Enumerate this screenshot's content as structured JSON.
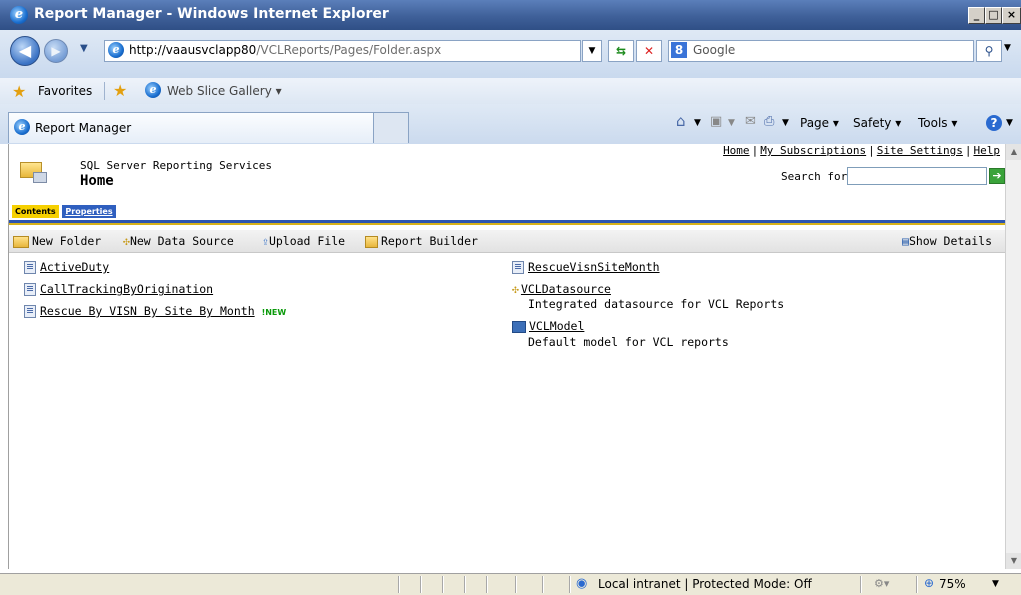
{
  "window": {
    "title": "Report Manager - Windows Internet Explorer",
    "controls": {
      "minimize": "_",
      "maximize": "□",
      "close": "×"
    }
  },
  "address_bar": {
    "url_host": "http://vaausvclapp80",
    "url_path": "/VCLReports/Pages/Folder.aspx",
    "search_placeholder": "Google"
  },
  "favorites_bar": {
    "favorites_label": "Favorites",
    "web_slice_label": "Web Slice Gallery ▾"
  },
  "tab": {
    "label": "Report Manager"
  },
  "command_bar": {
    "page_label": "Page ▾",
    "safety_label": "Safety ▾",
    "tools_label": "Tools ▾"
  },
  "report_manager": {
    "top_links": [
      "Home",
      "My Subscriptions",
      "Site Settings",
      "Help"
    ],
    "product": "SQL Server Reporting Services",
    "page_title": "Home",
    "search_label": "Search for:",
    "tabs": {
      "contents": "Contents",
      "properties": "Properties"
    },
    "toolbar": {
      "new_folder": "New Folder",
      "new_data_source": "New Data Source",
      "upload_file": "Upload File",
      "report_builder": "Report Builder",
      "show_details": "Show Details"
    },
    "left_items": [
      {
        "name": "ActiveDuty"
      },
      {
        "name": "CallTrackingByOrigination"
      },
      {
        "name": "Rescue By VISN By Site By Month",
        "badge": "!NEW"
      }
    ],
    "right_items": [
      {
        "name": "RescueVisnSiteMonth",
        "description": ""
      },
      {
        "name": "VCLDatasource",
        "description": "Integrated datasource for VCL Reports"
      },
      {
        "name": "VCLModel",
        "description": "Default model for VCL reports"
      }
    ]
  },
  "status_bar": {
    "zone": "Local intranet | Protected Mode: Off",
    "zoom": "75%"
  },
  "colors": {
    "title_bar": "#3f6099",
    "contents_tab": "#f6d000",
    "properties_tab": "#2f5fbf",
    "rule_blue": "#2d55b0"
  }
}
